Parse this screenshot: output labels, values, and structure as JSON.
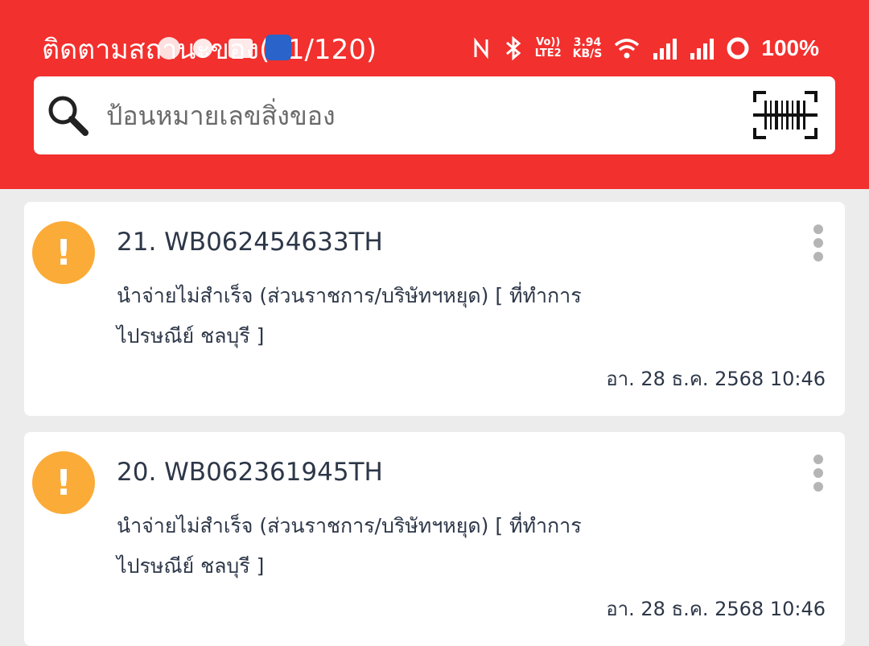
{
  "status_bar": {
    "title": "ติดตามสถานะของ",
    "counter": "(21/120)",
    "network_speed_value": "3.94",
    "network_speed_unit": "KB/S",
    "volte_top": "Vo))",
    "volte_bottom": "LTE2",
    "battery": "100%"
  },
  "search": {
    "placeholder": "ป้อนหมายเลขสิ่งของ"
  },
  "items": [
    {
      "title": "21. WB062454633TH",
      "status": "นำจ่ายไม่สำเร็จ (ส่วนราชการ/บริษัทฯหยุด) [ ที่ทำการไปรษณีย์ ชลบุรี ]",
      "date": "อา. 28 ธ.ค. 2568 10:46",
      "alert_symbol": "!"
    },
    {
      "title": "20. WB062361945TH",
      "status": "นำจ่ายไม่สำเร็จ (ส่วนราชการ/บริษัทฯหยุด) [ ที่ทำการไปรษณีย์ ชลบุรี ]",
      "date": "อา. 28 ธ.ค. 2568 10:46",
      "alert_symbol": "!"
    }
  ],
  "colors": {
    "header": "#f2302e",
    "alert": "#fbab37",
    "background": "#ececec"
  }
}
